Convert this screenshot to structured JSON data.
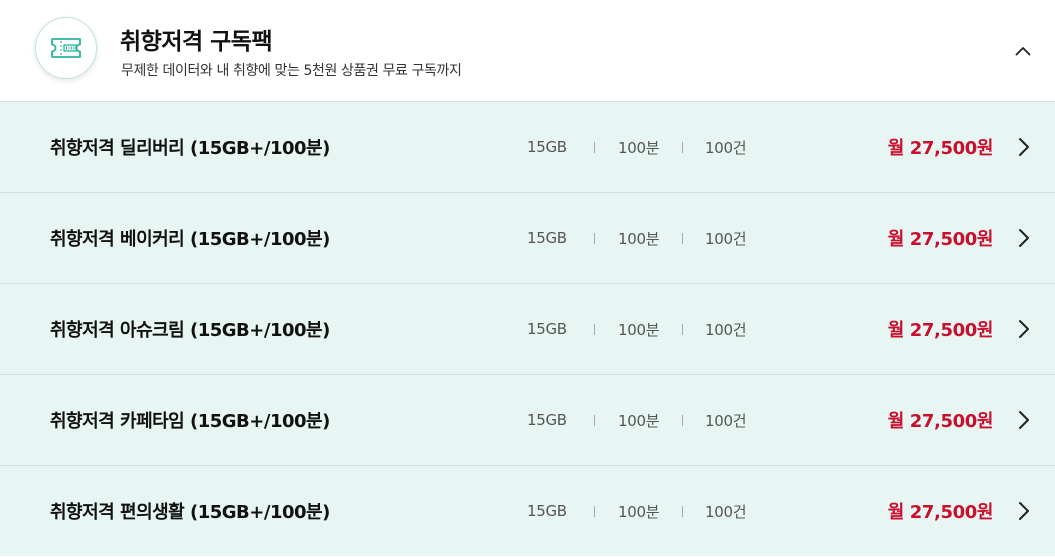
{
  "header": {
    "title": "취향저격 구독팩",
    "subtitle": "무제한 데이터와 내 취향에 맞는 5천원 상품권 무료 구독까지",
    "icon": "ticket-icon",
    "collapse_icon": "chevron-up-icon"
  },
  "colors": {
    "row_background": "#e8f6f3",
    "price": "#c8102e",
    "icon_accent": "#2bb5a2"
  },
  "plans": [
    {
      "name": "취향저격 딜리버리 (15GB+/100분)",
      "data": "15GB",
      "voice": "100분",
      "messages": "100건",
      "price": "월 27,500원"
    },
    {
      "name": "취향저격 베이커리 (15GB+/100분)",
      "data": "15GB",
      "voice": "100분",
      "messages": "100건",
      "price": "월 27,500원"
    },
    {
      "name": "취향저격 아슈크림 (15GB+/100분)",
      "data": "15GB",
      "voice": "100분",
      "messages": "100건",
      "price": "월 27,500원"
    },
    {
      "name": "취향저격 카페타임 (15GB+/100분)",
      "data": "15GB",
      "voice": "100분",
      "messages": "100건",
      "price": "월 27,500원"
    },
    {
      "name": "취향저격 편의생활 (15GB+/100분)",
      "data": "15GB",
      "voice": "100분",
      "messages": "100건",
      "price": "월 27,500원"
    }
  ]
}
